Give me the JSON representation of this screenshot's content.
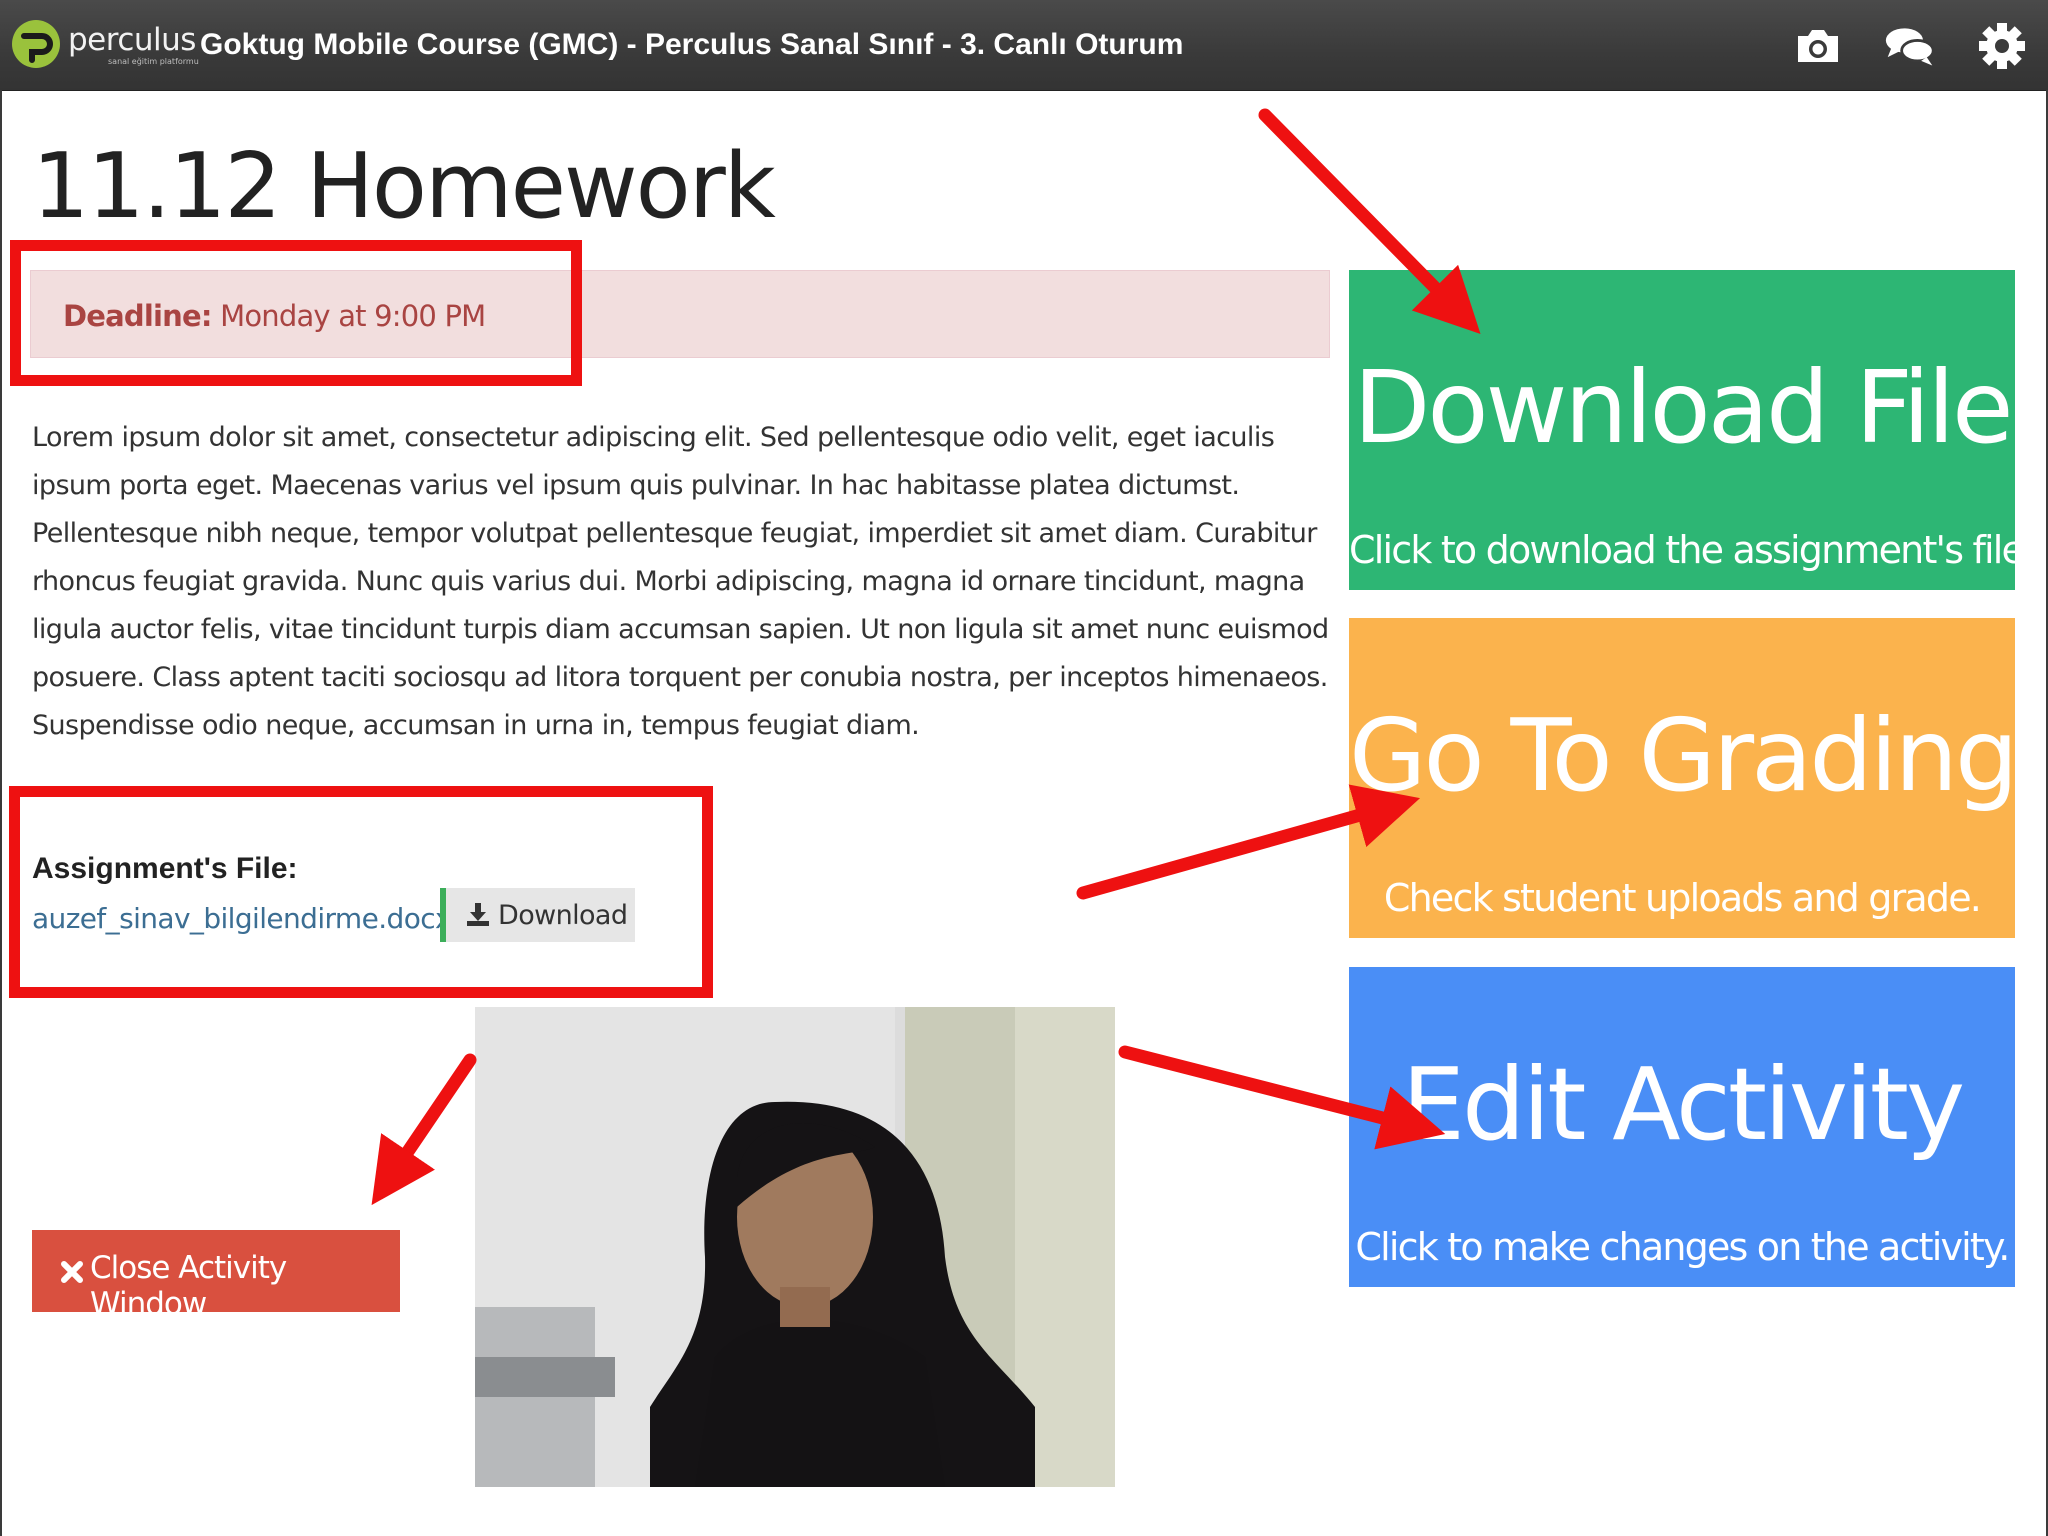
{
  "topbar": {
    "logo_text": "perculus",
    "logo_subtext": "sanal eğitim platformu",
    "title": "Goktug Mobile Course (GMC) - Perculus Sanal Sınıf - 3. Canlı Oturum",
    "icons": [
      "camera-icon",
      "chat-icon",
      "gear-icon"
    ]
  },
  "activity": {
    "heading": "11.12 Homework",
    "deadline_label": "Deadline:",
    "deadline_value": "Monday at 9:00 PM",
    "description": "Lorem ipsum dolor sit amet, consectetur adipiscing elit. Sed pellentesque odio velit, eget iaculis ipsum porta eget. Maecenas varius vel ipsum quis pulvinar. In hac habitasse platea dictumst. Pellentesque nibh neque, tempor volutpat pellentesque feugiat, imperdiet sit amet diam. Curabitur rhoncus feugiat gravida. Nunc quis varius dui. Morbi adipiscing, magna id ornare tincidunt, magna ligula auctor felis, vitae tincidunt turpis diam accumsan sapien. Ut non ligula sit amet nunc euismod posuere. Class aptent taciti sociosqu ad litora torquent per conubia nostra, per inceptos himenaeos. Suspendisse odio neque, accumsan in urna in, tempus feugiat diam.",
    "file_label": "Assignment's File:",
    "file_name": "auzef_sinav_bilgilendirme.docx",
    "download_label": "Download",
    "close_label": "Close Activity Window"
  },
  "tiles": {
    "download": {
      "title": "Download File",
      "subtitle": "Click to download the assignment's file.",
      "color": "#2db674"
    },
    "grading": {
      "title": "Go To Grading",
      "subtitle": "Check student uploads and grade.",
      "color": "#fbb34d"
    },
    "edit": {
      "title": "Edit Activity",
      "subtitle": "Click to make changes on the activity.",
      "color": "#4a8ef6"
    }
  },
  "colors": {
    "annotation": "#ee1111",
    "deadline_bg": "#f2dede",
    "deadline_text": "#a94442",
    "close_button": "#d9503f"
  }
}
